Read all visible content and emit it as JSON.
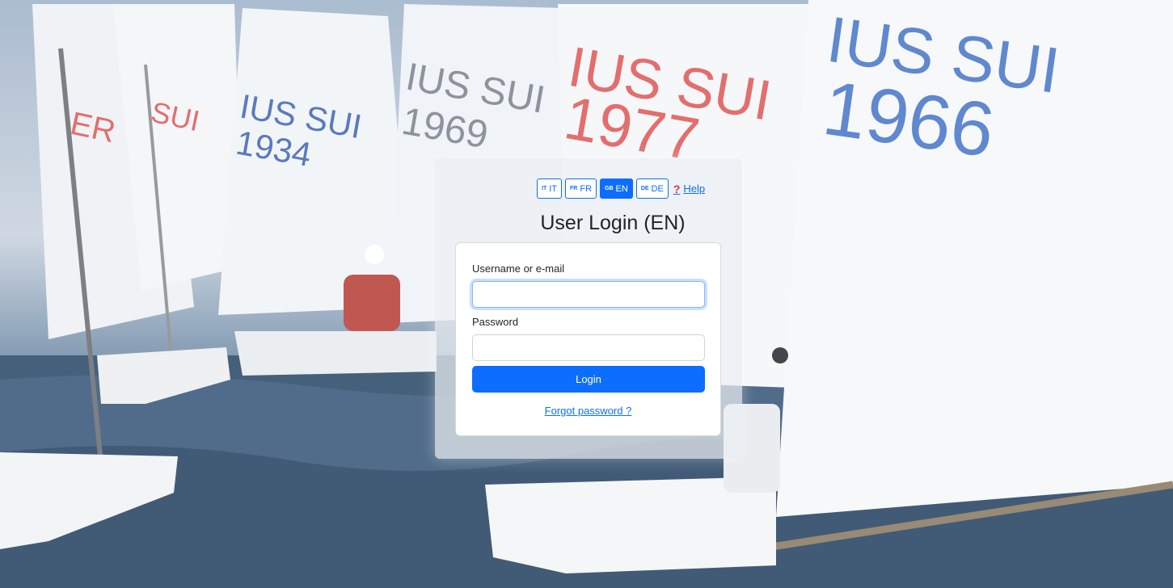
{
  "colors": {
    "primary": "#0d6efd",
    "help_icon": "#dc3545"
  },
  "languages": [
    {
      "code": "IT",
      "label": "IT",
      "active": false
    },
    {
      "code": "FR",
      "label": "FR",
      "active": false
    },
    {
      "code": "GB",
      "label": "EN",
      "active": true
    },
    {
      "code": "DE",
      "label": "DE",
      "active": false
    }
  ],
  "help": {
    "icon": "question-mark-icon",
    "label": "Help"
  },
  "title": "User Login (EN)",
  "form": {
    "username_label": "Username or e-mail",
    "username_value": "",
    "password_label": "Password",
    "password_value": "",
    "login_label": "Login",
    "forgot_label": "Forgot password ?"
  },
  "background": {
    "description_icon": "sailboats-background-image",
    "sail_texts": [
      "SUI",
      "1966",
      "SUI",
      "1977",
      "SUI",
      "1969",
      "SUI",
      "1934"
    ]
  }
}
